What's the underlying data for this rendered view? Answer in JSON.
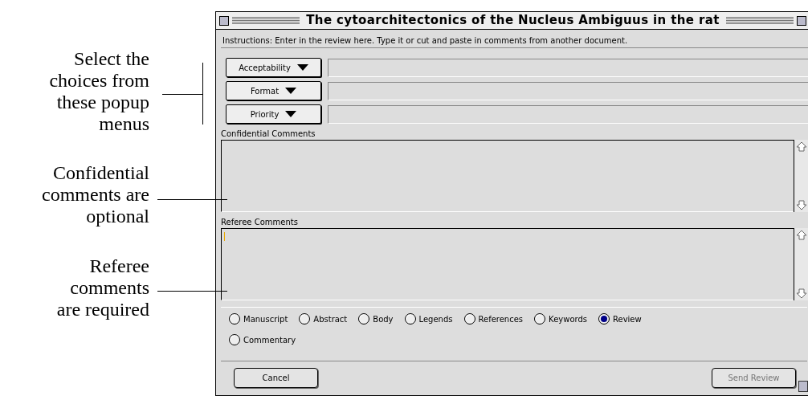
{
  "callouts": [
    {
      "kind": "bracket",
      "lines": [
        "Select the",
        "choices from",
        "these popup",
        "menus"
      ]
    },
    {
      "kind": "line",
      "lines": [
        "Confidential",
        "comments are",
        "optional"
      ]
    },
    {
      "kind": "line",
      "lines": [
        "Referee",
        "comments",
        "are required"
      ]
    }
  ],
  "window": {
    "title": "The cytoarchitectonics of the Nucleus Ambiguus in the rat"
  },
  "instructions": "Instructions: Enter in the review here. Type it or cut and paste in comments from another document.",
  "popups": [
    {
      "label": "Acceptability"
    },
    {
      "label": "Format"
    },
    {
      "label": "Priority"
    }
  ],
  "comment_boxes": [
    {
      "label": "Confidential Comments",
      "focused": false
    },
    {
      "label": "Referee Comments",
      "focused": true
    }
  ],
  "radios": [
    {
      "label": "Manuscript",
      "selected": false
    },
    {
      "label": "Abstract",
      "selected": false
    },
    {
      "label": "Body",
      "selected": false
    },
    {
      "label": "Legends",
      "selected": false
    },
    {
      "label": "References",
      "selected": false
    },
    {
      "label": "Keywords",
      "selected": false
    },
    {
      "label": "Review",
      "selected": true
    },
    {
      "label": "Commentary",
      "selected": false
    }
  ],
  "buttons": [
    {
      "label": "Cancel",
      "disabled": false
    },
    {
      "label": "Send Review",
      "disabled": true
    }
  ]
}
